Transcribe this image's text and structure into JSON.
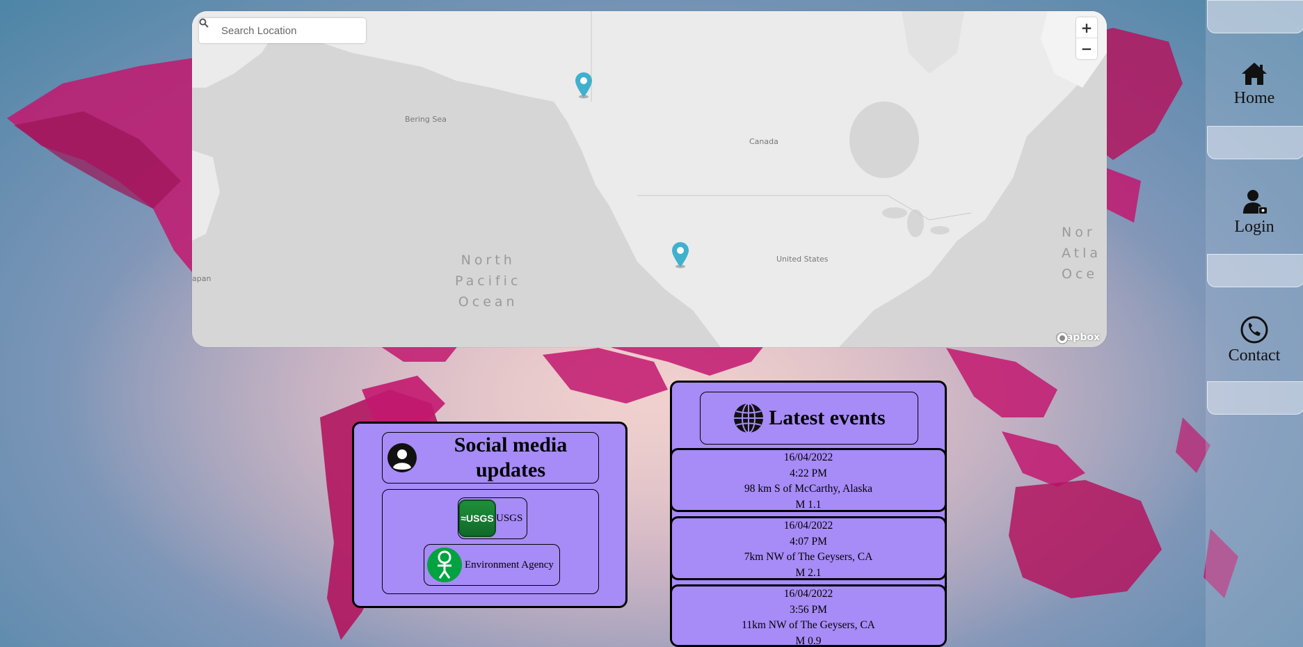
{
  "map": {
    "search_placeholder": "Search Location",
    "zoom_in": "+",
    "zoom_out": "−",
    "attribution": "mapbox",
    "labels": {
      "bering_sea": "Bering Sea",
      "canada": "Canada",
      "united_states": "United States",
      "japan": "apan",
      "north_pacific": [
        "North",
        "Pacific",
        "Ocean"
      ],
      "north_atlantic": [
        "Nor",
        "Atla",
        "Oce"
      ]
    }
  },
  "nav": {
    "items": [
      {
        "label": "Home",
        "icon": "home-icon"
      },
      {
        "label": "Login",
        "icon": "user-lock-icon"
      },
      {
        "label": "Contact",
        "icon": "phone-icon"
      }
    ]
  },
  "social": {
    "title_line1": "Social media",
    "title_line2": "updates",
    "sources": [
      {
        "label": "USGS",
        "logo_text": "≈USGS"
      },
      {
        "label": "Environment Agency"
      }
    ]
  },
  "events": {
    "title": "Latest events",
    "items": [
      {
        "date": "16/04/2022",
        "time": "4:22 PM",
        "location": "98 km S of McCarthy, Alaska",
        "magnitude": "M 1.1"
      },
      {
        "date": "16/04/2022",
        "time": "4:07 PM",
        "location": "7km NW of The Geysers, CA",
        "magnitude": "M 2.1"
      },
      {
        "date": "16/04/2022",
        "time": "3:56 PM",
        "location": "11km NW of The Geysers, CA",
        "magnitude": "M 0.9"
      }
    ]
  },
  "colors": {
    "card_bg": "#a78bf7",
    "marker": "#3fb1ce",
    "land_bg": "#c2186e"
  }
}
